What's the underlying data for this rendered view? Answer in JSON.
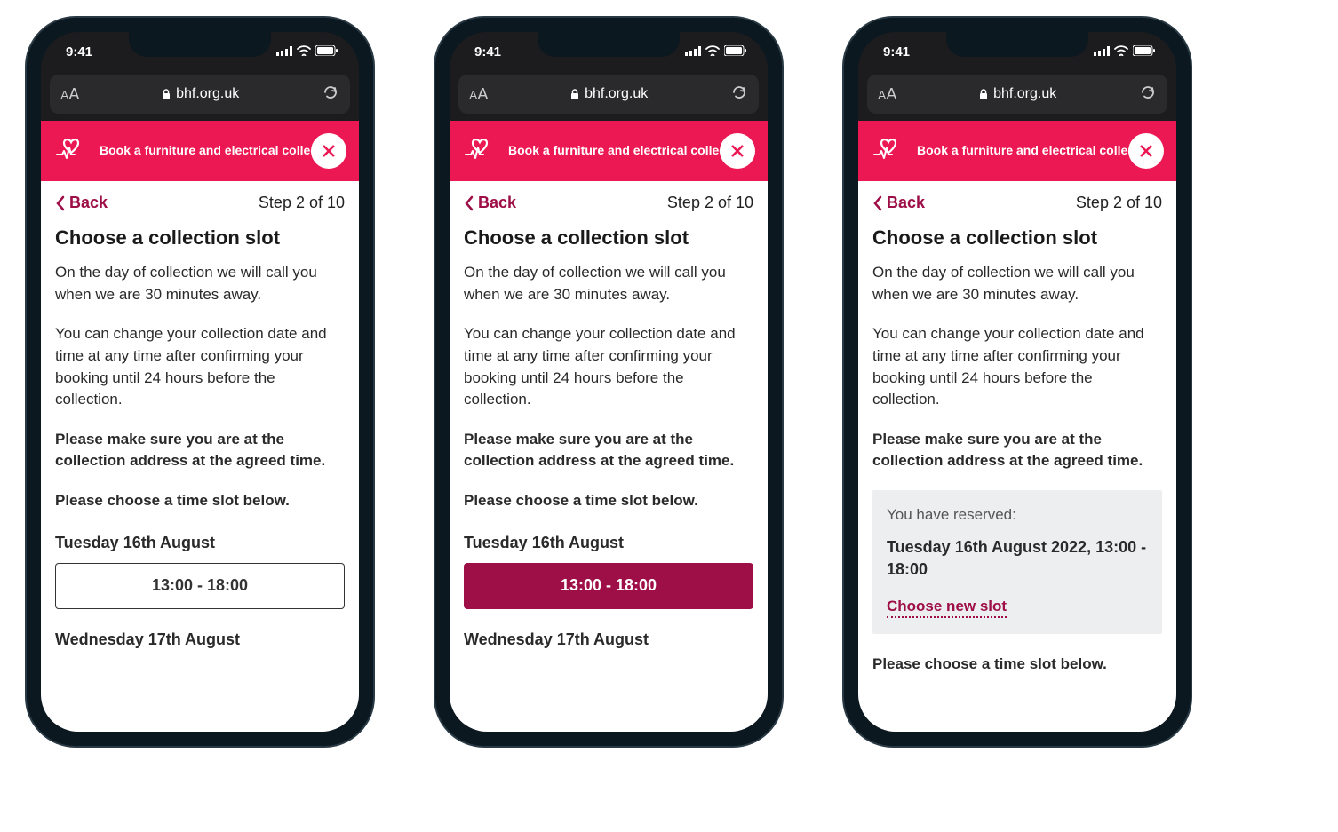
{
  "statusBar": {
    "time": "9:41"
  },
  "browser": {
    "url": "bhf.org.uk"
  },
  "header": {
    "title": "Book a furniture and electrical collection"
  },
  "nav": {
    "back": "Back",
    "step": "Step 2 of 10"
  },
  "page": {
    "title": "Choose a collection slot",
    "para1": "On the day of collection we will call you when we are 30 minutes away.",
    "para2": "You can change your collection date and time at any time after confirming your booking until 24 hours before the collection.",
    "para3": "Please make sure you are at the collection address at the agreed time.",
    "para4": "Please choose a time slot below."
  },
  "slots": {
    "date1": "Tuesday 16th August",
    "time1": "13:00 - 18:00",
    "date2": "Wednesday 17th August"
  },
  "reserved": {
    "label": "You have reserved:",
    "value": "Tuesday 16th August 2022, 13:00 - 18:00",
    "chooseNew": "Choose new slot"
  }
}
